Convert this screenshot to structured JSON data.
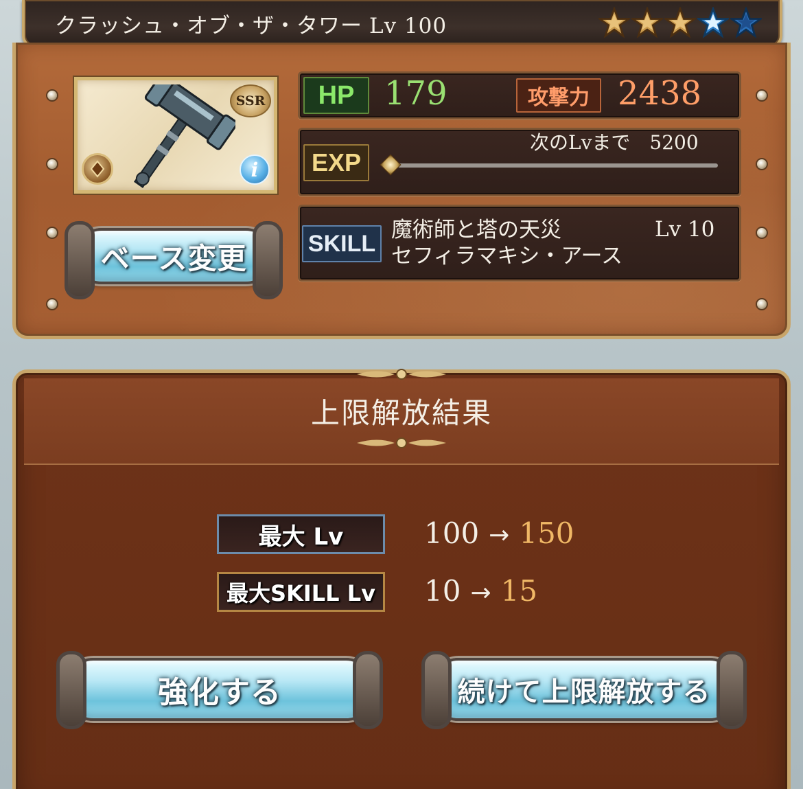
{
  "weapon": {
    "name": "クラッシュ・オブ・ザ・タワー",
    "level": "Lv 100",
    "rarity": "SSR",
    "info_label": "i",
    "stars": {
      "filled": 5,
      "gold": 3,
      "blue": 2
    }
  },
  "stats": {
    "hp_label": "HP",
    "hp_value": "179",
    "atk_label": "攻撃力",
    "atk_value": "2438",
    "exp_label": "EXP",
    "exp_next": "次のLvまで　5200",
    "exp_progress": 0
  },
  "skill": {
    "label": "SKILL",
    "name_line1": "魔術師と塔の天災",
    "name_line2": "セフィラマキシ・アース",
    "level": "Lv 10"
  },
  "buttons": {
    "change_base": "ベース変更",
    "enhance": "強化する",
    "continue_uncap": "続けて上限解放する"
  },
  "result": {
    "title": "上限解放結果",
    "rows": [
      {
        "label": "最大 Lv",
        "from": "100",
        "arrow": "→",
        "to": "150"
      },
      {
        "label": "最大SKILL Lv",
        "from": "10",
        "arrow": "→",
        "to": "15"
      }
    ]
  },
  "colors": {
    "hp": "#9ae072",
    "atk": "#ff9e68",
    "uncap_to": "#f0b866",
    "panel_brown": "#a35c30"
  }
}
